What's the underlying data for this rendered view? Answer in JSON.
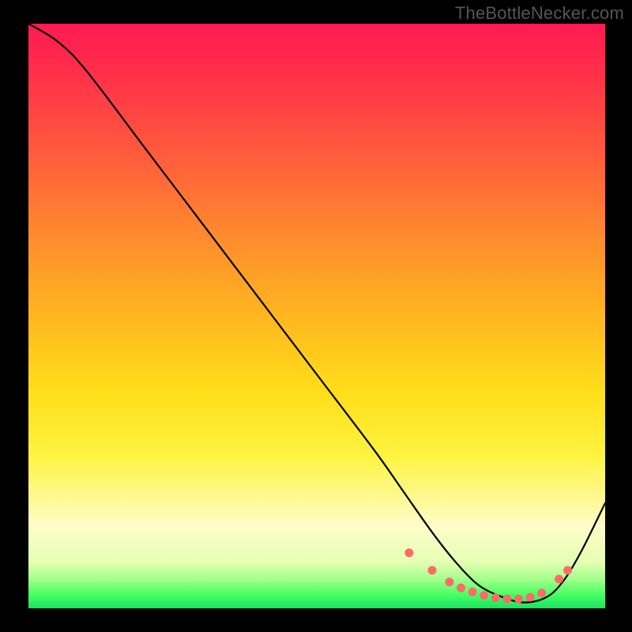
{
  "watermark": "TheBottleNecker.com",
  "chart_data": {
    "type": "line",
    "title": "",
    "xlabel": "",
    "ylabel": "",
    "xlim": [
      0,
      100
    ],
    "ylim": [
      0,
      100
    ],
    "series": [
      {
        "name": "curve",
        "x": [
          0,
          5,
          10,
          20,
          30,
          40,
          50,
          60,
          65,
          70,
          74,
          78,
          82,
          86,
          90,
          93,
          96,
          100
        ],
        "values": [
          100,
          97,
          92,
          79,
          66,
          53,
          40,
          27,
          20,
          13,
          8,
          4,
          2,
          1,
          2,
          5,
          10,
          18
        ]
      }
    ],
    "markers": {
      "name": "trough-dots",
      "x": [
        66,
        70,
        73,
        75,
        77,
        79,
        81,
        83,
        85,
        87,
        89,
        92,
        93.5
      ],
      "values": [
        9.5,
        6.5,
        4.5,
        3.5,
        2.8,
        2.2,
        1.8,
        1.6,
        1.6,
        1.9,
        2.6,
        5.0,
        6.5
      ]
    },
    "background_gradient": {
      "stops": [
        {
          "pct": 0,
          "color": "#ff1a52"
        },
        {
          "pct": 50,
          "color": "#ffde1a"
        },
        {
          "pct": 86,
          "color": "#fdfdc9"
        },
        {
          "pct": 100,
          "color": "#13e85a"
        }
      ]
    }
  }
}
